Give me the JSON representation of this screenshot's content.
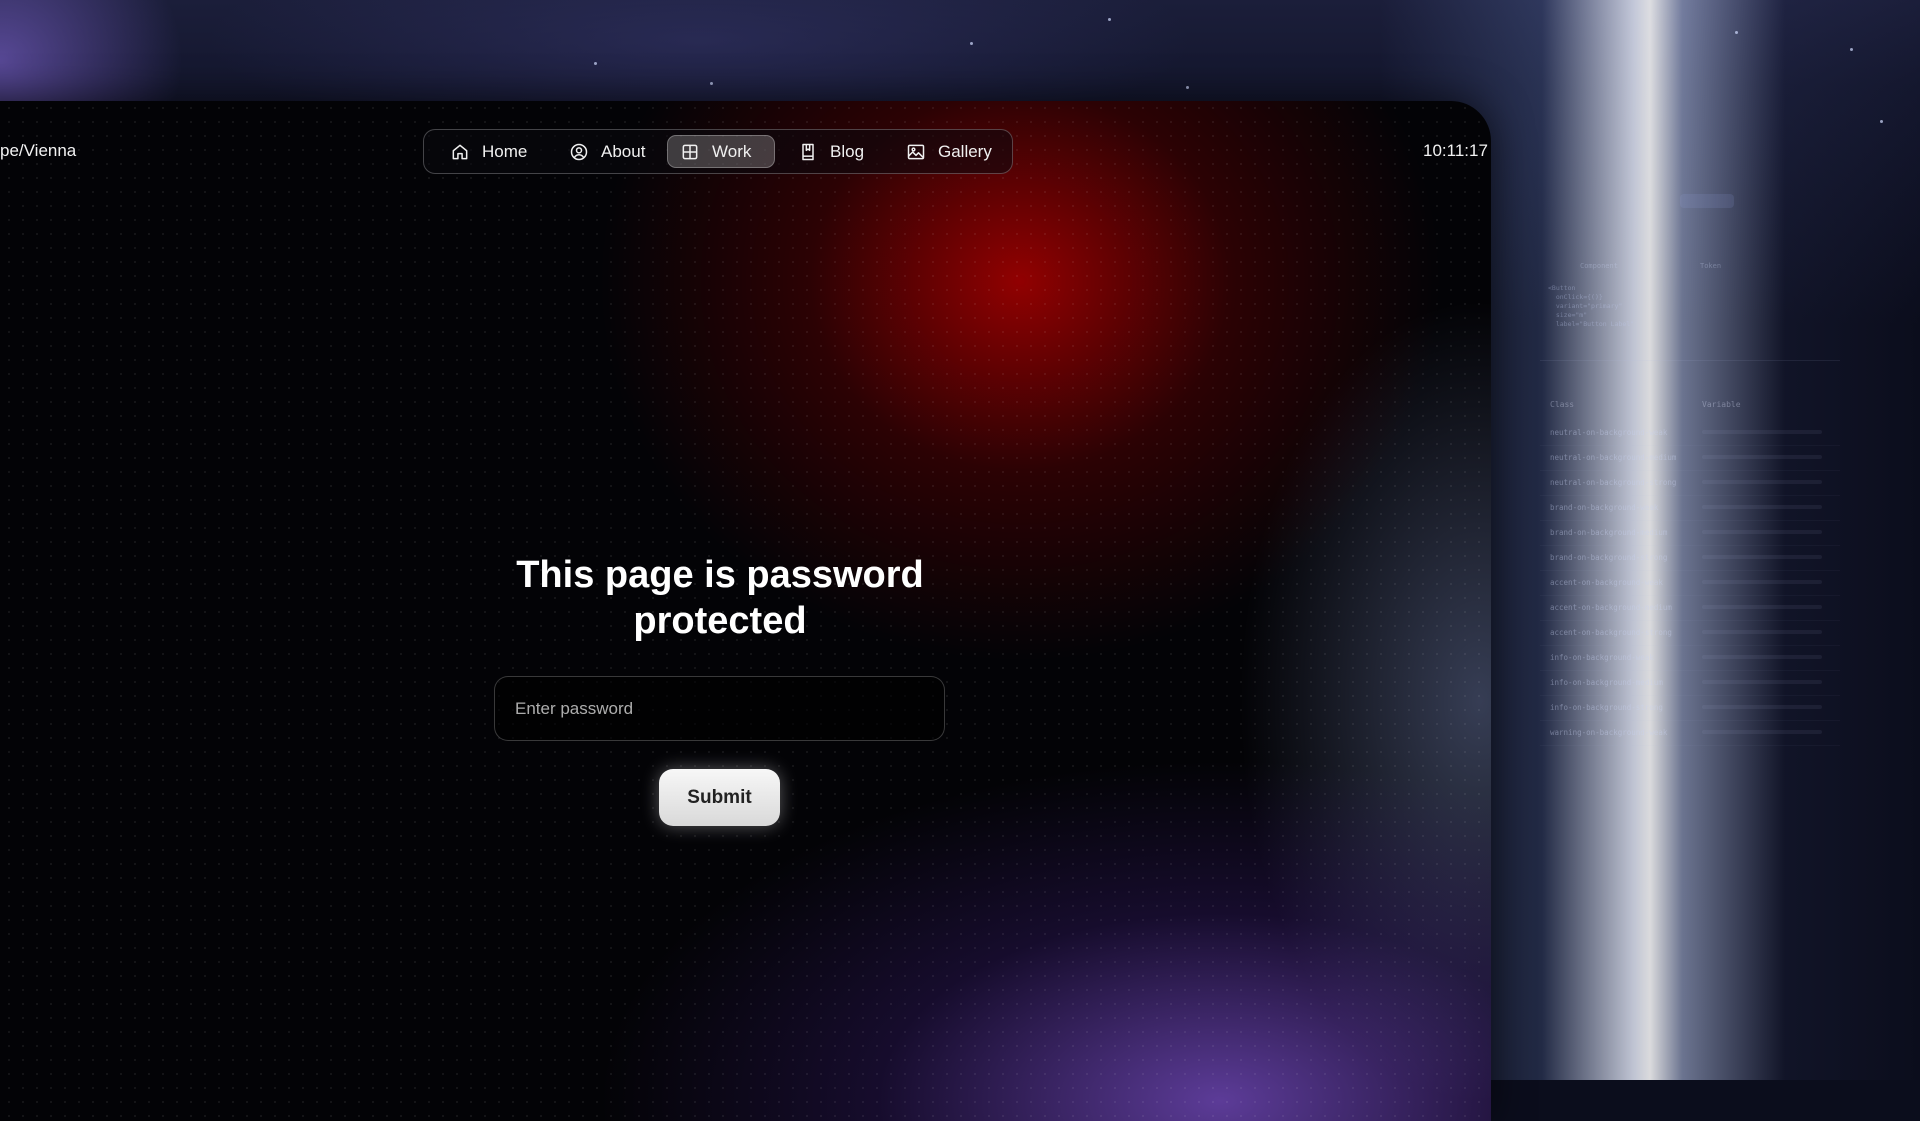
{
  "header": {
    "timezone": "pe/Vienna",
    "time": "10:11:17"
  },
  "nav": {
    "items": [
      {
        "label": "Home",
        "icon": "home-icon",
        "active": false
      },
      {
        "label": "About",
        "icon": "user-circle-icon",
        "active": false
      },
      {
        "label": "Work",
        "icon": "grid-icon",
        "active": true
      },
      {
        "label": "Blog",
        "icon": "book-icon",
        "active": false
      },
      {
        "label": "Gallery",
        "icon": "image-icon",
        "active": false
      }
    ]
  },
  "main": {
    "title": "This page is password protected",
    "password_placeholder": "Enter password",
    "submit_label": "Submit"
  },
  "colors": {
    "accent_red": "#aa0000",
    "accent_purple": "#8c5ae6",
    "background": "#030306"
  }
}
